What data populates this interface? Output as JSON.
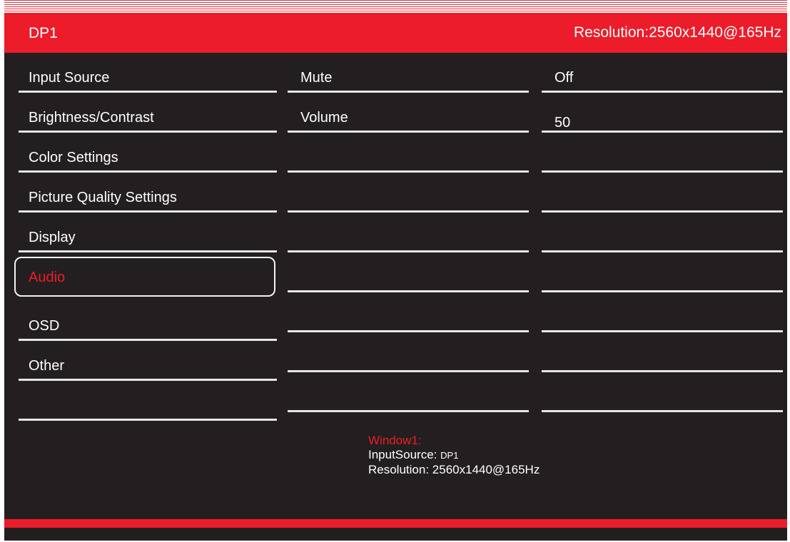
{
  "header": {
    "source": "DP1",
    "resolution": "Resolution:2560x1440@165Hz"
  },
  "menu": {
    "items": [
      {
        "label": "Input Source"
      },
      {
        "label": "Brightness/Contrast"
      },
      {
        "label": "Color Settings"
      },
      {
        "label": "Picture Quality Settings"
      },
      {
        "label": "Display"
      },
      {
        "label": "Audio"
      },
      {
        "label": "OSD"
      },
      {
        "label": "Other"
      },
      {
        "label": ""
      }
    ],
    "selected": "Audio"
  },
  "submenu": {
    "items": [
      {
        "label": "Mute"
      },
      {
        "label": "Volume"
      }
    ]
  },
  "values": {
    "items": [
      {
        "value": "Off"
      },
      {
        "value": "50"
      }
    ]
  },
  "info": {
    "window_title": "Window1:",
    "input_source_label": "InputSource:",
    "input_source_value": "DP1",
    "resolution_label": "Resolution:",
    "resolution_value": "2560x1440@165Hz"
  },
  "colors": {
    "accent": "#ec1c2a",
    "background": "#231f20",
    "text": "#ffffff",
    "divider": "#e6e6e6"
  }
}
